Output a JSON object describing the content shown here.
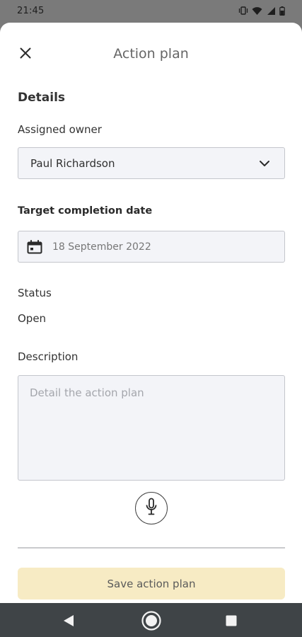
{
  "status_bar": {
    "time": "21:45",
    "icons": [
      "vibrate-icon",
      "wifi-icon",
      "signal-icon",
      "battery-icon"
    ]
  },
  "sheet": {
    "title": "Action plan",
    "close_icon": "close-icon"
  },
  "details": {
    "heading": "Details",
    "assigned_owner": {
      "label": "Assigned owner",
      "value": "Paul Richardson"
    },
    "target_date": {
      "label": "Target completion date",
      "value": "18 September 2022"
    },
    "status": {
      "label": "Status",
      "value": "Open"
    },
    "description": {
      "label": "Description",
      "placeholder": "Detail the action plan",
      "value": ""
    }
  },
  "actions": {
    "save_label": "Save action plan",
    "save_color": "#f7ebc4"
  },
  "nav_bar": {
    "buttons": [
      "back-icon",
      "home-icon",
      "recents-icon"
    ]
  }
}
